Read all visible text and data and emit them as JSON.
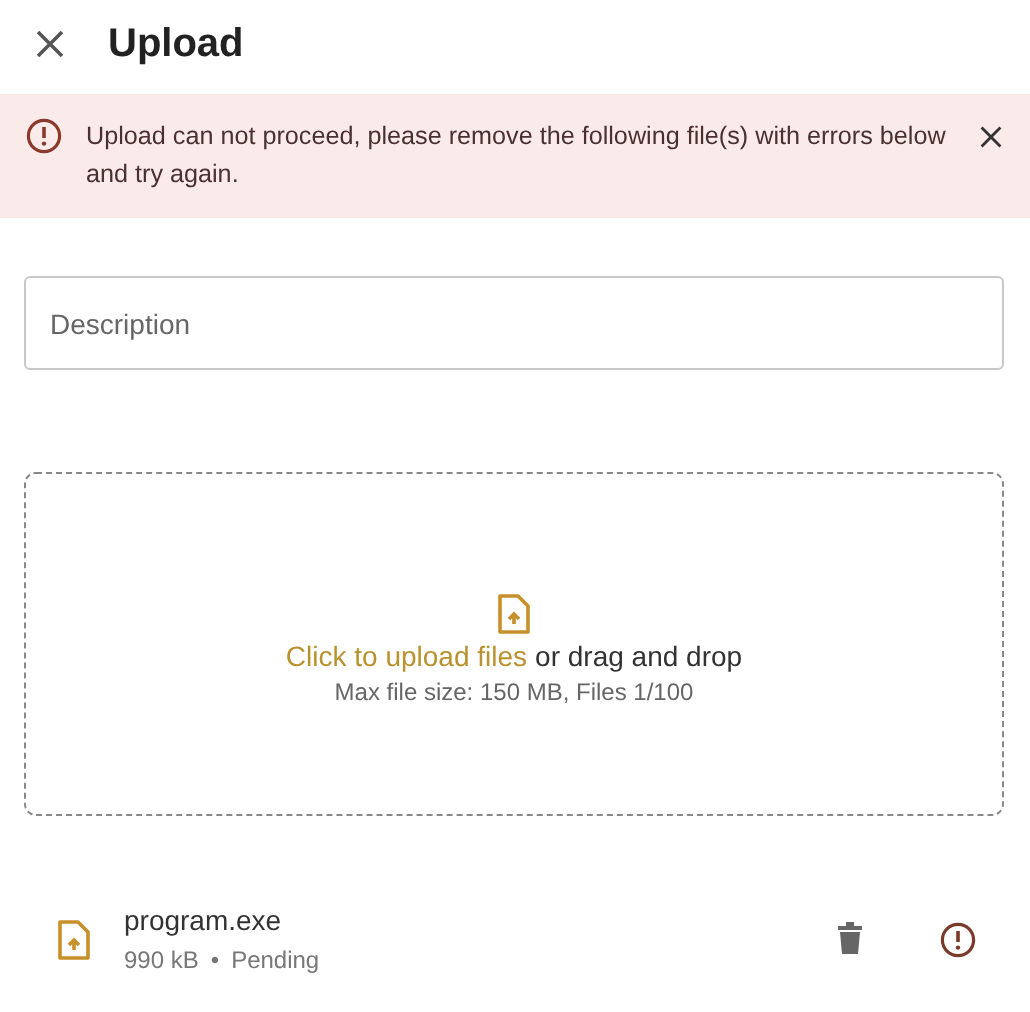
{
  "header": {
    "title": "Upload"
  },
  "alert": {
    "error": true,
    "message": "Upload can not proceed, please remove the following file(s) with errors below and try again."
  },
  "description": {
    "placeholder": "Description"
  },
  "dropzone": {
    "link": "Click to upload files",
    "text": "or drag and drop",
    "hint": "Max file size: 150 MB, Files 1/100"
  },
  "files": [
    {
      "name": "program.exe",
      "size": "990 kB",
      "separator": "•",
      "status": "Pending",
      "error": true
    }
  ]
}
